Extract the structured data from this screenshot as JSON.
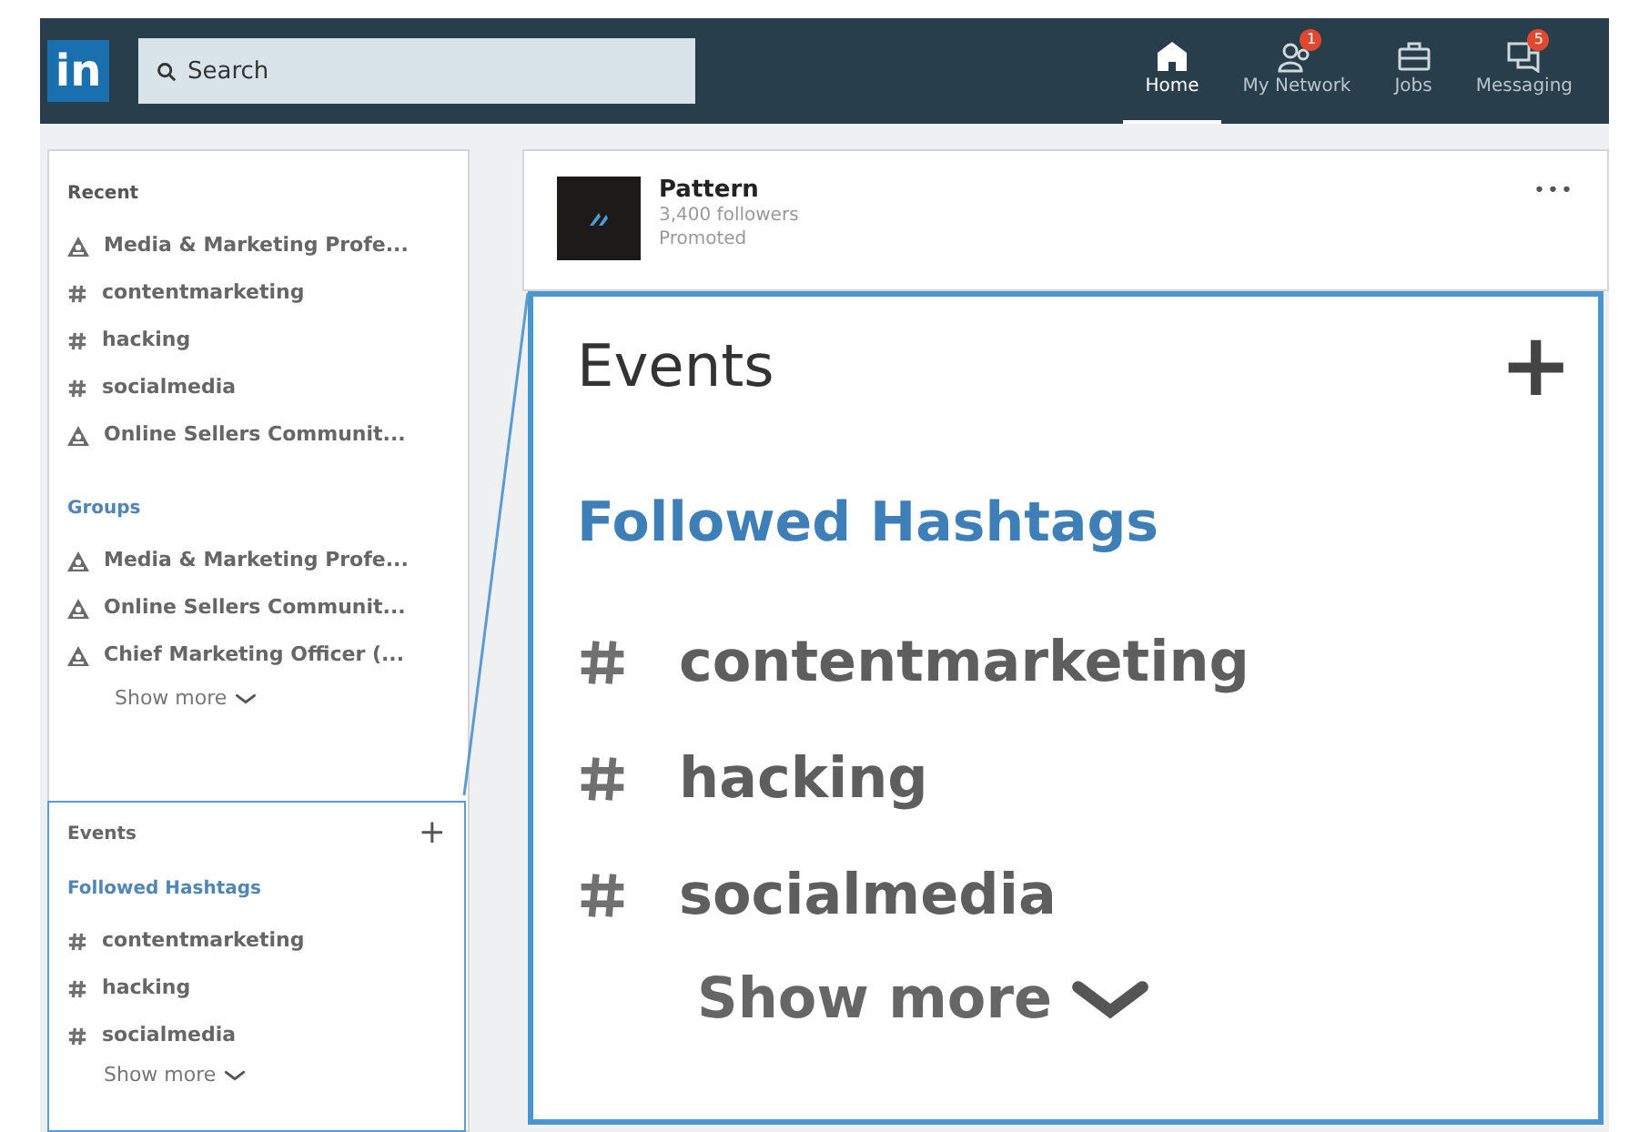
{
  "nav": {
    "logo": "in",
    "search": {
      "placeholder": "Search"
    },
    "items": [
      {
        "label": "Home",
        "selected": true
      },
      {
        "label": "My Network",
        "selected": false,
        "badge": "1"
      },
      {
        "label": "Jobs",
        "selected": false
      },
      {
        "label": "Messaging",
        "selected": false,
        "badge": "5"
      }
    ]
  },
  "sidebar": {
    "sections": [
      {
        "title": "Recent",
        "items": [
          {
            "kind": "group",
            "label": "Media & Marketing Profe..."
          },
          {
            "kind": "hashtag",
            "label": "contentmarketing"
          },
          {
            "kind": "hashtag",
            "label": "hacking"
          },
          {
            "kind": "hashtag",
            "label": "socialmedia"
          },
          {
            "kind": "group",
            "label": "Online Sellers Communit..."
          }
        ]
      },
      {
        "title": "Groups",
        "items": [
          {
            "kind": "group",
            "label": "Media & Marketing Profe..."
          },
          {
            "kind": "group",
            "label": "Online Sellers Communit..."
          },
          {
            "kind": "group",
            "label": "Chief Marketing Officer (..."
          }
        ],
        "show_more": "Show more"
      }
    ]
  },
  "events_panel": {
    "title": "Events",
    "add": "+",
    "hashtags_title": "Followed Hashtags",
    "hashtags": [
      "contentmarketing",
      "hacking",
      "socialmedia"
    ],
    "show_more": "Show more"
  },
  "post": {
    "company": "Pattern",
    "followers": "3,400 followers",
    "label": "Promoted",
    "menu": "•••"
  },
  "zoomed_panel": {
    "title": "Events",
    "add": "+",
    "hashtags_title": "Followed Hashtags",
    "hashtags": [
      "contentmarketing",
      "hacking",
      "socialmedia"
    ],
    "show_more": "Show more"
  }
}
